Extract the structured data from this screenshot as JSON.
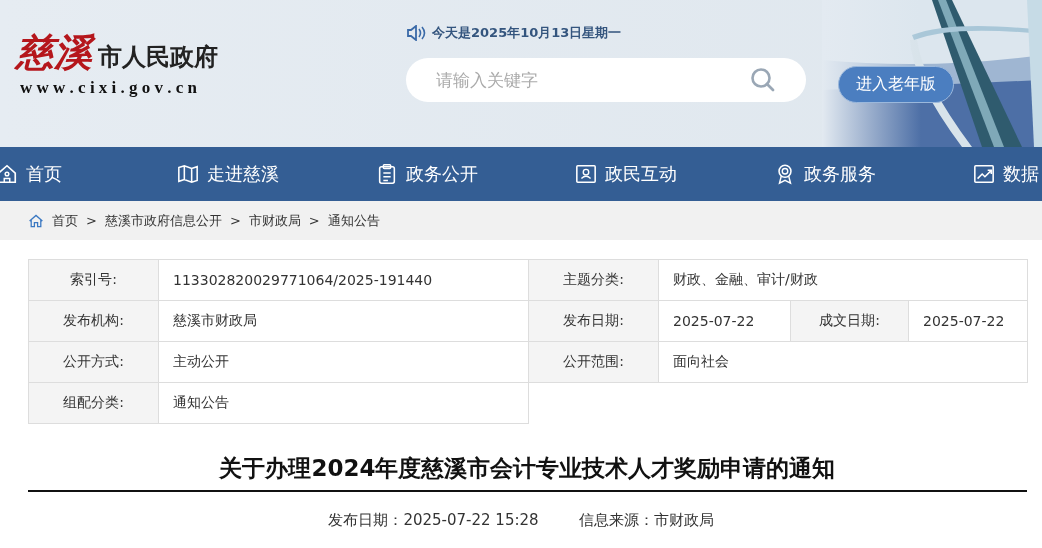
{
  "header": {
    "logo_calligraphy": "慈溪",
    "logo_title": "市人民政府",
    "logo_url": "w w w . c i x i . g o v . c n",
    "date": "今天是2025年10月13日星期一",
    "search": {
      "placeholder": "请输入关键字"
    },
    "elder_button": "进入老年版"
  },
  "nav": [
    {
      "label": "首页"
    },
    {
      "label": "走进慈溪"
    },
    {
      "label": "政务公开"
    },
    {
      "label": "政民互动"
    },
    {
      "label": "政务服务"
    },
    {
      "label": "数据"
    }
  ],
  "breadcrumb": {
    "separator": ">",
    "items": [
      "首页",
      "慈溪市政府信息公开",
      "市财政局",
      "通知公告"
    ]
  },
  "info": [
    [
      {
        "label": "索引号:",
        "value": "113302820029771064/2025-191440"
      },
      {
        "label": "主题分类:",
        "value": "财政、金融、审计/财政"
      }
    ],
    [
      {
        "label": "发布机构:",
        "value": "慈溪市财政局"
      },
      {
        "label": "发布日期:",
        "value": "2025-07-22"
      },
      {
        "label": "成文日期:",
        "value": "2025-07-22"
      }
    ],
    [
      {
        "label": "公开方式:",
        "value": "主动公开"
      },
      {
        "label": "公开范围:",
        "value": "面向社会"
      }
    ],
    [
      {
        "label": "组配分类:",
        "value": "通知公告"
      }
    ]
  ],
  "article": {
    "title": "关于办理2024年度慈溪市会计专业技术人才奖励申请的通知",
    "published": "发布日期：2025-07-22 15:28",
    "source": "信息来源：市财政局"
  }
}
